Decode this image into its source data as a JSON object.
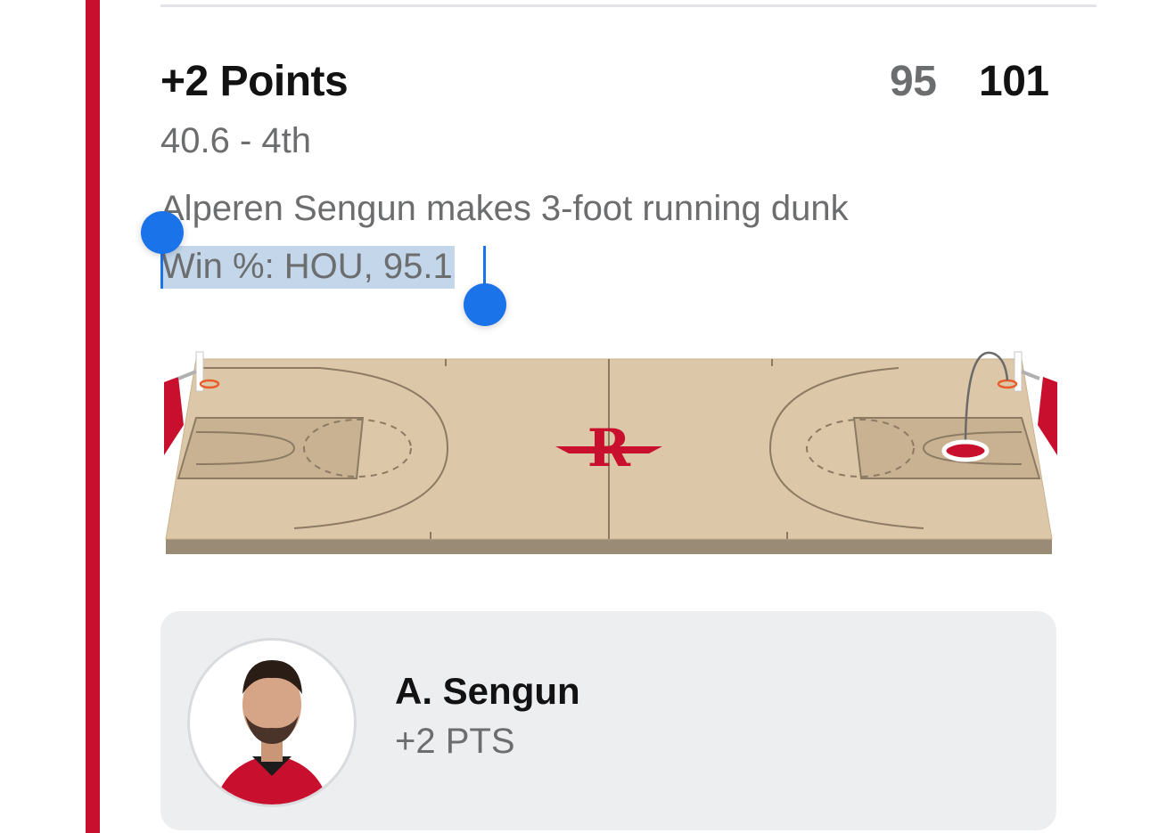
{
  "play": {
    "title": "+2 Points",
    "clock": "40.6 - 4th",
    "description": "Alperen Sengun makes 3-foot running dunk",
    "win_probability": "Win %: HOU, 95.1"
  },
  "score": {
    "away": "95",
    "home": "101"
  },
  "court": {
    "logo_letter": "R",
    "shot_result": "made",
    "team_color": "#c8102e",
    "floor_color": "#dcc7a8"
  },
  "player": {
    "name": "A. Sengun",
    "stat": "+2 PTS"
  },
  "colors": {
    "team_primary": "#c8102e",
    "selection_highlight": "#c4d6ea",
    "selection_handle": "#1a73e8",
    "muted_text": "#6c6d6f"
  }
}
